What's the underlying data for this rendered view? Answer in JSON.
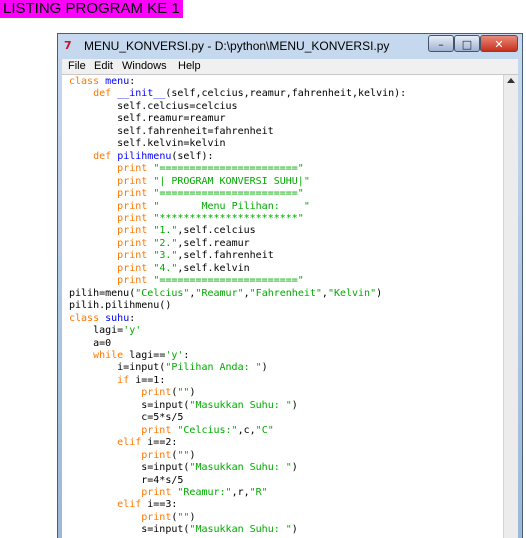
{
  "page": {
    "heading": "LISTING PROGRAM KE 1"
  },
  "window": {
    "title": "MENU_KONVERSI.py - D:\\python\\MENU_KONVERSI.py",
    "app_icon": "python-file-icon",
    "buttons": {
      "minimize": "minimize-icon",
      "maximize": "maximize-icon",
      "close": "close-icon"
    }
  },
  "menu": {
    "items": [
      "File",
      "Edit",
      "Windows",
      "Help"
    ]
  },
  "code": {
    "lines": [
      [
        [
          "kw",
          "class"
        ],
        [
          "",
          ""
        ],
        [
          "",
          " "
        ],
        [
          "def",
          "menu"
        ],
        [
          "",
          ":"
        ]
      ],
      [
        [
          "",
          "    "
        ],
        [
          "kw",
          "def"
        ],
        [
          "",
          " "
        ],
        [
          "def",
          "__init__"
        ],
        [
          "",
          "(self,celcius,reamur,fahrenheit,kelvin):"
        ]
      ],
      [
        [
          "",
          "        self.celcius=celcius"
        ]
      ],
      [
        [
          "",
          "        self.reamur=reamur"
        ]
      ],
      [
        [
          "",
          "        self.fahrenheit=fahrenheit"
        ]
      ],
      [
        [
          "",
          "        self.kelvin=kelvin"
        ]
      ],
      [
        [
          "",
          "    "
        ],
        [
          "kw",
          "def"
        ],
        [
          "",
          " "
        ],
        [
          "def",
          "pilihmenu"
        ],
        [
          "",
          "(self):"
        ]
      ],
      [
        [
          "",
          "        "
        ],
        [
          "kw",
          "print"
        ],
        [
          "",
          " "
        ],
        [
          "str",
          "\"=======================\""
        ]
      ],
      [
        [
          "",
          "        "
        ],
        [
          "kw",
          "print"
        ],
        [
          "",
          " "
        ],
        [
          "str",
          "\"| PROGRAM KONVERSI SUHU|\""
        ]
      ],
      [
        [
          "",
          "        "
        ],
        [
          "kw",
          "print"
        ],
        [
          "",
          " "
        ],
        [
          "str",
          "\"=======================\""
        ]
      ],
      [
        [
          "",
          "        "
        ],
        [
          "kw",
          "print"
        ],
        [
          "",
          " "
        ],
        [
          "str",
          "\"       Menu Pilihan:    \""
        ]
      ],
      [
        [
          "",
          "        "
        ],
        [
          "kw",
          "print"
        ],
        [
          "",
          " "
        ],
        [
          "str",
          "\"***********************\""
        ]
      ],
      [
        [
          "",
          "        "
        ],
        [
          "kw",
          "print"
        ],
        [
          "",
          " "
        ],
        [
          "str",
          "\"1.\""
        ],
        [
          "",
          ",self.celcius"
        ]
      ],
      [
        [
          "",
          "        "
        ],
        [
          "kw",
          "print"
        ],
        [
          "",
          " "
        ],
        [
          "str",
          "\"2.\""
        ],
        [
          "",
          ",self.reamur"
        ]
      ],
      [
        [
          "",
          "        "
        ],
        [
          "kw",
          "print"
        ],
        [
          "",
          " "
        ],
        [
          "str",
          "\"3.\""
        ],
        [
          "",
          ",self.fahrenheit"
        ]
      ],
      [
        [
          "",
          "        "
        ],
        [
          "kw",
          "print"
        ],
        [
          "",
          " "
        ],
        [
          "str",
          "\"4.\""
        ],
        [
          "",
          ",self.kelvin"
        ]
      ],
      [
        [
          "",
          "        "
        ],
        [
          "kw",
          "print"
        ],
        [
          "",
          " "
        ],
        [
          "str",
          "\"=======================\""
        ]
      ],
      [
        [
          "",
          "pilih=menu("
        ],
        [
          "str",
          "\"Celcius\""
        ],
        [
          "",
          ","
        ],
        [
          "str",
          "\"Reamur\""
        ],
        [
          "",
          ","
        ],
        [
          "str",
          "\"Fahrenheit\""
        ],
        [
          "",
          ","
        ],
        [
          "str",
          "\"Kelvin\""
        ],
        [
          "",
          ")"
        ]
      ],
      [
        [
          "",
          "pilih.pilihmenu()"
        ]
      ],
      [
        [
          "kw",
          "class"
        ],
        [
          "",
          " "
        ],
        [
          "def",
          "suhu"
        ],
        [
          "",
          ":"
        ]
      ],
      [
        [
          "",
          "    lagi="
        ],
        [
          "str",
          "'y'"
        ]
      ],
      [
        [
          "",
          "    a=0"
        ]
      ],
      [
        [
          "",
          "    "
        ],
        [
          "kw",
          "while"
        ],
        [
          "",
          " lagi=="
        ],
        [
          "str",
          "'y'"
        ],
        [
          "",
          ":"
        ]
      ],
      [
        [
          "",
          "        i=input("
        ],
        [
          "str",
          "\"Pilihan Anda: \""
        ],
        [
          "",
          ")"
        ]
      ],
      [
        [
          "",
          "        "
        ],
        [
          "kw",
          "if"
        ],
        [
          "",
          " i==1:"
        ]
      ],
      [
        [
          "",
          "            "
        ],
        [
          "kw",
          "print"
        ],
        [
          "",
          "("
        ],
        [
          "str",
          "\"\""
        ],
        [
          "",
          ")"
        ]
      ],
      [
        [
          "",
          "            s=input("
        ],
        [
          "str",
          "\"Masukkan Suhu: \""
        ],
        [
          "",
          ")"
        ]
      ],
      [
        [
          "",
          "            c=5*s/5"
        ]
      ],
      [
        [
          "",
          "            "
        ],
        [
          "kw",
          "print"
        ],
        [
          "",
          " "
        ],
        [
          "str",
          "\"Celcius:\""
        ],
        [
          "",
          ",c,"
        ],
        [
          "str",
          "\"C\""
        ]
      ],
      [
        [
          "",
          "        "
        ],
        [
          "kw",
          "elif"
        ],
        [
          "",
          " i==2:"
        ]
      ],
      [
        [
          "",
          "            "
        ],
        [
          "kw",
          "print"
        ],
        [
          "",
          "("
        ],
        [
          "str",
          "\"\""
        ],
        [
          "",
          ")"
        ]
      ],
      [
        [
          "",
          "            s=input("
        ],
        [
          "str",
          "\"Masukkan Suhu: \""
        ],
        [
          "",
          ")"
        ]
      ],
      [
        [
          "",
          "            r=4*s/5"
        ]
      ],
      [
        [
          "",
          "            "
        ],
        [
          "kw",
          "print"
        ],
        [
          "",
          " "
        ],
        [
          "str",
          "\"Reamur:\""
        ],
        [
          "",
          ",r,"
        ],
        [
          "str",
          "\"R\""
        ]
      ],
      [
        [
          "",
          "        "
        ],
        [
          "kw",
          "elif"
        ],
        [
          "",
          " i==3:"
        ]
      ],
      [
        [
          "",
          "            "
        ],
        [
          "kw",
          "print"
        ],
        [
          "",
          "("
        ],
        [
          "str",
          "\"\""
        ],
        [
          "",
          ")"
        ]
      ],
      [
        [
          "",
          "            s=input("
        ],
        [
          "str",
          "\"Masukkan Suhu: \""
        ],
        [
          "",
          ")"
        ]
      ]
    ]
  },
  "colors": {
    "keyword": "#ff7700",
    "string": "#00aa00",
    "definition": "#0000ff",
    "heading_bg": "#ff00ff"
  }
}
